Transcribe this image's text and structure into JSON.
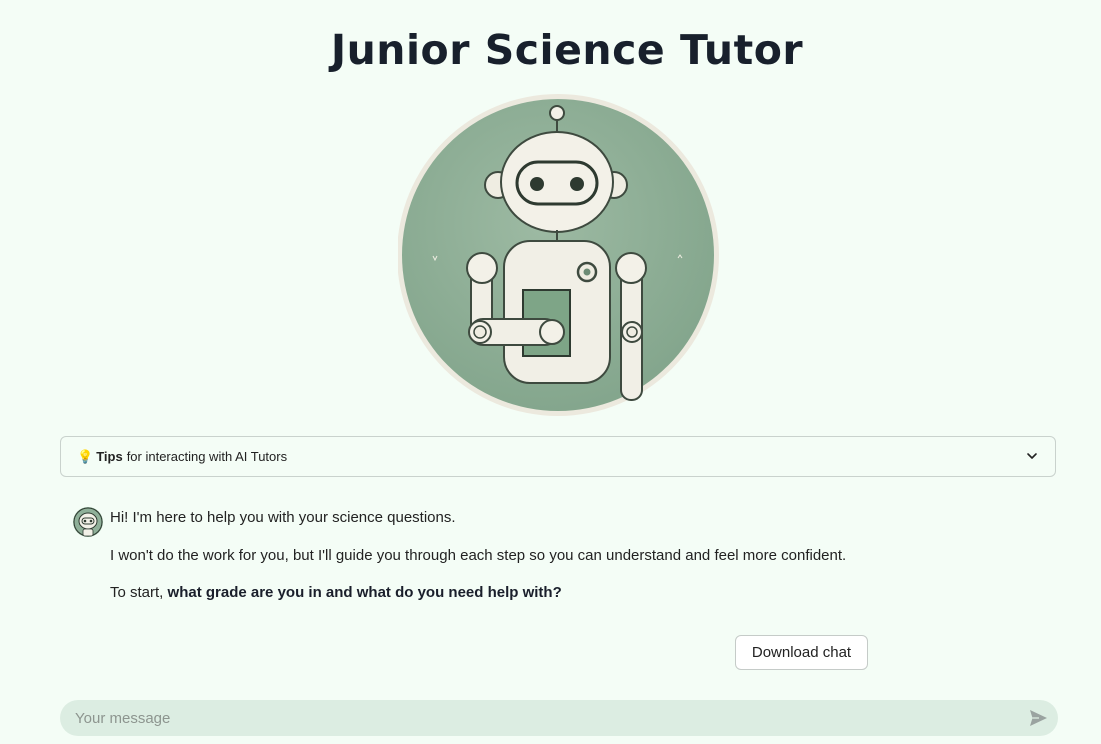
{
  "header": {
    "title": "Junior Science Tutor"
  },
  "hero": {
    "image": "robot-illustration",
    "background_color": "#8fb099"
  },
  "tips": {
    "icon": "lightbulb-icon",
    "bold_label": "Tips",
    "label": "for interacting with AI Tutors",
    "expand_icon": "chevron-down-icon"
  },
  "chat": {
    "assistant_avatar": "robot-avatar",
    "messages": [
      "Hi! I'm here to help you with your science questions.",
      "I won't do the work for you, but I'll guide you through each step so you can understand and feel more confident."
    ],
    "prompt_prefix": "To start,",
    "prompt_bold": "what grade are you in and what do you need help with?",
    "download_label": "Download chat"
  },
  "composer": {
    "placeholder": "Your message",
    "value": "",
    "send_icon": "send-icon"
  },
  "colors": {
    "background": "#f4fdf6",
    "input_background": "#dcede2",
    "robot_green": "#8fb099"
  }
}
